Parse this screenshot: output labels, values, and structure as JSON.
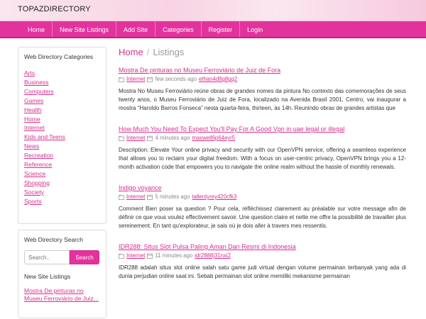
{
  "brand": "TOPAZDIRECTORY",
  "nav": [
    "Home",
    "New Site Listings",
    "Add Site",
    "Categories",
    "Register",
    "Login"
  ],
  "sidebar": {
    "categories_title": "Web Directory Categories",
    "categories": [
      "Arts",
      "Business",
      "Computers",
      "Games",
      "Health",
      "Home",
      "Internet",
      "Kids and Teens",
      "News",
      "Recreation",
      "Reference",
      "Science",
      "Shopping",
      "Society",
      "Sports"
    ],
    "search_title": "Web Directory Search",
    "search_placeholder": "Search..",
    "search_button": "Search",
    "new_listings_title": "New Site Listings",
    "new_listing_link": "Mostra De pinturas no Museu Ferroviário de Juiz..."
  },
  "breadcrumb": {
    "home": "Home",
    "current": "Listings"
  },
  "listings": [
    {
      "title": "Mostra De pinturas no Museu Ferroviário de Juiz de Fora",
      "category": "Internet",
      "time": "few seconds ago",
      "user": "ethan4d8g8gq2",
      "description": "Mostra No Museu Ferroviário reúne obras de grandes nomes da pintura No contexto das comemorações de seus twenty anos, o Museu Ferroviário de Juiz de Fora, localizado na Avenida Brasil 2001, Centro, vai inaugurar a mostra “Haroldo Barros Fonseca” nesta quarta-feira, thirteen, às 14h. Reunindo obras de grandes artistas que"
    },
    {
      "title": "How Much You Need To Expect You'll Pay For A Good Vpn in uae legal or illegal",
      "category": "Internet",
      "time": "4 minutes ago",
      "user": "maxwell6p64eyr5",
      "description": "Description: Elevate Your online privacy and security with our OpenVPN service, offering a seamless experience that allows you to reclaim your digital freedom. With a focus on user-centric privacy, OpenVPN brings you a 12-month activation code that empowers you to navigate the online realm without the hassle of monthly renewals."
    },
    {
      "title": "Indigo voyance",
      "category": "Internet",
      "time": "5 minutes ago",
      "user": "tallentyrey420cfk3",
      "description": "Comment Bien poser sa question ? Pour cela, réfléchissez clairement au préalable sur votre message afin de définir ce que vous voulez effectivement savoir. Une question claire et nette me offre la possibilité de travailler plus sereinement. En tant qu'explorateur, je sais où je dois aller à travers mes ressentis."
    },
    {
      "title": "IDR288: Situs Slot Pulsa Paling Aman Dan Resmi di Indonesia",
      "category": "Internet",
      "time": "11 minutes ago",
      "user": "idr2888j31nxi2",
      "description": "IDR288 adalah situs slot online salah satu game judi virtual dengan volume permainan terbanyak yang ada di dunia perjudian online saat ini. Sebab permainan slot online memiliki mekanisme permainan"
    }
  ]
}
